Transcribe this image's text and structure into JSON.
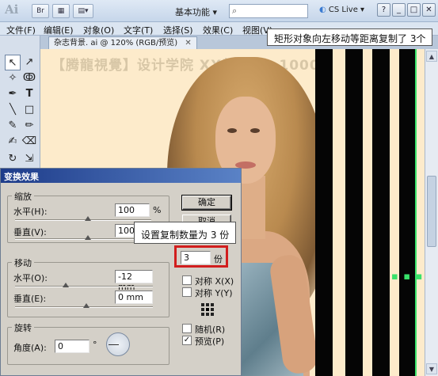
{
  "app": {
    "logo_text": "Ai",
    "br_label": "Br",
    "workspace_label": "基本功能 ▾",
    "cs_live_label": "CS Live ▾",
    "search_icon": "search-icon",
    "window_buttons": [
      "?",
      "_",
      "□",
      "✕"
    ]
  },
  "menu": [
    "文件(F)",
    "编辑(E)",
    "对象(O)",
    "文字(T)",
    "选择(S)",
    "效果(C)",
    "视图(V)"
  ],
  "callouts": {
    "top": "矩形对象向左移动等距离复制了 3个",
    "mid": "设置复制数量为 3 份"
  },
  "document": {
    "tab_label": "杂志背景. ai @ 120% (RGB/预览)",
    "close": "✕",
    "watermark": "【腾龍視覺】设计学院  XX频道 ID 1000"
  },
  "tools": {
    "items": [
      "selection-arrow",
      "direct-select",
      "magic-wand",
      "lasso",
      "pen",
      "type",
      "line",
      "rectangle",
      "brush",
      "pencil",
      "eraser",
      "rotate",
      "scale",
      "warp"
    ]
  },
  "dialog": {
    "title": "变换效果",
    "scale_group": "缩放",
    "horizontal_label": "水平(H):",
    "horizontal_value": "100",
    "vertical_label": "垂直(V):",
    "vertical_value": "100",
    "percent": "%",
    "ok": "确定",
    "cancel": "取消",
    "copies_value": "3",
    "copies_unit": "份",
    "move_group": "移动",
    "move_h_label": "水平(O):",
    "move_h_value": "-12 mm",
    "move_v_label": "垂直(E):",
    "move_v_value": "0 mm",
    "reflect_x": "对称 X(X)",
    "reflect_y": "对称 Y(Y)",
    "rotate_group": "旋转",
    "angle_label": "角度(A):",
    "angle_value": "0",
    "degree": "°",
    "random": "随机(R)",
    "preview": "预览(P)",
    "preview_checked": "✓"
  }
}
